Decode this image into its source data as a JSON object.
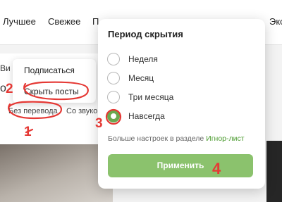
{
  "nav": {
    "items": [
      "Лучшее",
      "Свежее",
      "П",
      "Эко"
    ]
  },
  "card": {
    "letter_top": "Ви",
    "letter_mid": "о"
  },
  "context_menu": {
    "subscribe": "Подписаться",
    "hide_posts": "Скрыть посты"
  },
  "filters": {
    "no_translation": "Без перевода",
    "with_sound": "Со звуко"
  },
  "popup": {
    "title": "Период скрытия",
    "options": [
      {
        "label": "Неделя",
        "checked": false
      },
      {
        "label": "Месяц",
        "checked": false
      },
      {
        "label": "Три месяца",
        "checked": false
      },
      {
        "label": "Навсегда",
        "checked": true
      }
    ],
    "more_settings_text": "Больше настроек в разделе",
    "ignore_list_link": "Игнор-лист",
    "apply_label": "Применить"
  },
  "annotations": {
    "step1": "1",
    "step2": "2",
    "step3": "3",
    "step4": "4",
    "color": "#e53935"
  },
  "colors": {
    "accent_green": "#8bc26d",
    "link_green": "#4a9a2e"
  }
}
